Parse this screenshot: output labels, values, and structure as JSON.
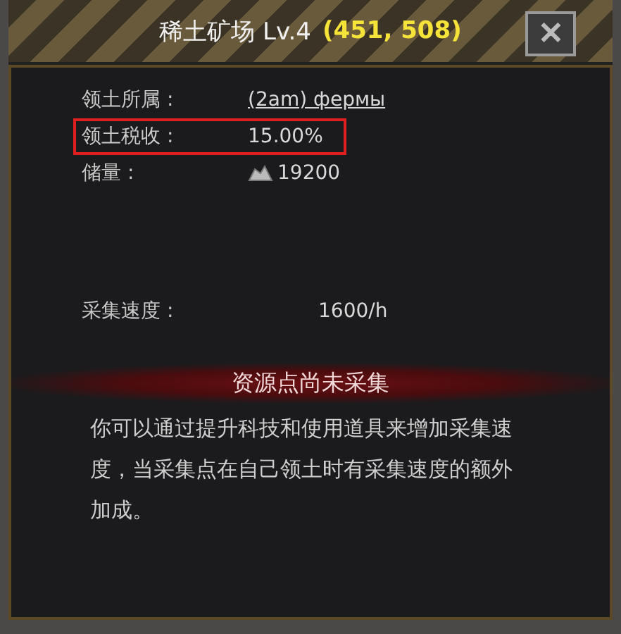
{
  "window": {
    "title": "稀土矿场 Lv.4",
    "coordinates": "(451, 508)",
    "close": "✕"
  },
  "info_rows": [
    {
      "label": "领土所属 :",
      "value": "(2am) фермы",
      "kind": "link",
      "highlighted": false
    },
    {
      "label": "领土税收 :",
      "value": "15.00%",
      "kind": "plain",
      "highlighted": true
    },
    {
      "label": "储量 :",
      "value": "19200",
      "kind": "resource",
      "highlighted": false
    }
  ],
  "speed": {
    "label": "采集速度 :",
    "value": "1600/h"
  },
  "status_banner": "资源点尚未采集",
  "description": "你可以通过提升科技和使用道具来增加采集速度，当采集点在自己领土时有采集速度的额外加成。"
}
